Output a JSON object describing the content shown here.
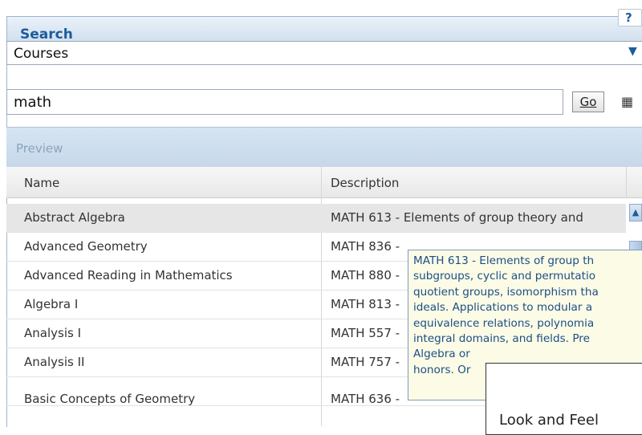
{
  "panel": {
    "title": "Search",
    "help_label": "?"
  },
  "search": {
    "scope_value": "Courses",
    "query_value": "math",
    "go_label": "Go"
  },
  "preview": {
    "label": "Preview"
  },
  "table": {
    "columns": [
      "Name",
      "Description"
    ],
    "rows": [
      {
        "name": "Abstract Algebra",
        "description": "MATH 613 - Elements of group theory and"
      },
      {
        "name": "Advanced Geometry",
        "description": "MATH 836 -"
      },
      {
        "name": "Advanced Reading in Mathematics",
        "description": "MATH 880 -"
      },
      {
        "name": "Algebra I",
        "description": "MATH 813 -"
      },
      {
        "name": "Analysis I",
        "description": "MATH 557 -"
      },
      {
        "name": "Analysis II",
        "description": "MATH 757 -"
      },
      {
        "name": "Basic Concepts of Geometry",
        "description": "MATH 636 -"
      }
    ]
  },
  "tooltip": {
    "lines": [
      "MATH 613 - Elements of group th",
      "subgroups, cyclic and permutatio",
      "quotient groups, isomorphism tha",
      "ideals. Applications to modular a",
      "equivalence relations, polynomia",
      "integral domains, and fields. Pre",
      "Algebra or",
      "honors. Or"
    ]
  },
  "look_and_feel": {
    "title": "Look and Feel"
  }
}
